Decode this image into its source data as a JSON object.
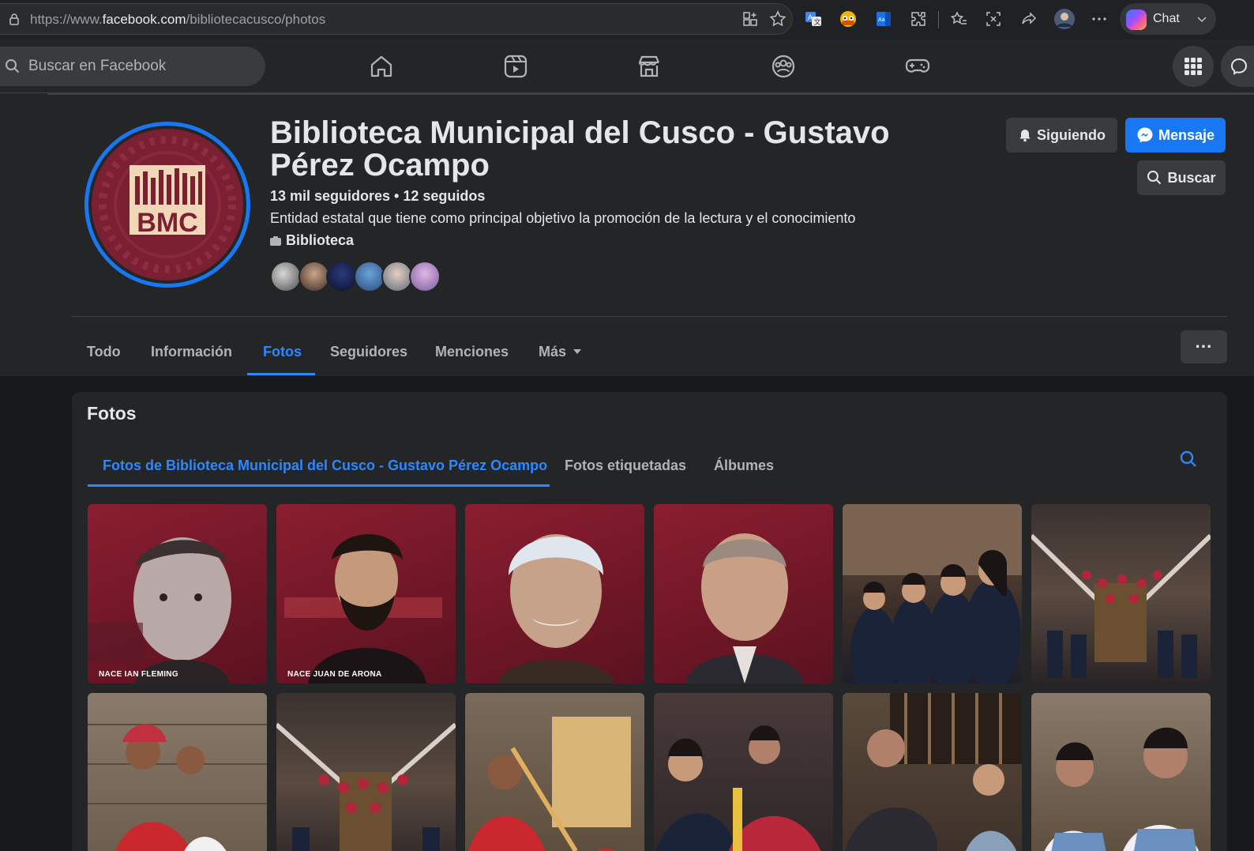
{
  "browser": {
    "url_prefix": "https://www.",
    "url_domain": "facebook.com",
    "url_path": "/bibliotecacusco/photos",
    "chat_label": "Chat"
  },
  "fb_nav": {
    "search_placeholder": "Buscar en Facebook"
  },
  "profile": {
    "title": "Biblioteca Municipal del Cusco - Gustavo Pérez Ocampo",
    "stats": "13 mil seguidores • 12 seguidos",
    "description": "Entidad estatal que tiene como principal objetivo la promoción de la lectura y el conocimiento",
    "category": "Biblioteca",
    "logo_text": "BMC",
    "following_label": "Siguiendo",
    "message_label": "Mensaje",
    "search_label": "Buscar",
    "more_label": "···"
  },
  "tabs": [
    {
      "label": "Todo"
    },
    {
      "label": "Información"
    },
    {
      "label": "Fotos"
    },
    {
      "label": "Seguidores"
    },
    {
      "label": "Menciones"
    },
    {
      "label": "Más"
    }
  ],
  "photos": {
    "title": "Fotos",
    "subtabs": [
      {
        "label": "Fotos de Biblioteca Municipal del Cusco - Gustavo Pérez Ocampo"
      },
      {
        "label": "Fotos etiquetadas"
      },
      {
        "label": "Álbumes"
      }
    ],
    "captions": [
      "NACE IAN FLEMING",
      "NACE JUAN DE ARONA"
    ]
  },
  "colors": {
    "accent": "#2d88ff",
    "brand_blue": "#1877f2",
    "logo_bg": "#7b1f33"
  }
}
